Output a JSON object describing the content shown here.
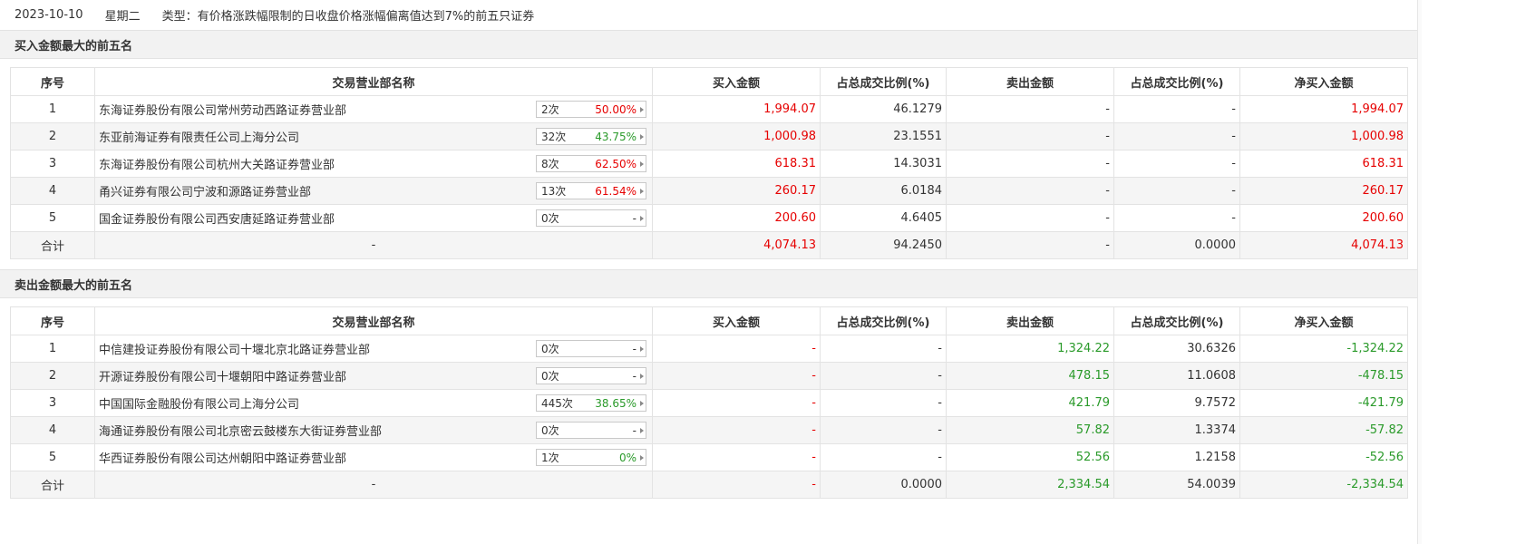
{
  "header": {
    "date": "2023-10-10",
    "weekday": "星期二",
    "type_text": "类型：有价格涨跌幅限制的日收盘价格涨幅偏离值达到7%的前五只证券"
  },
  "columns": [
    "序号",
    "交易营业部名称",
    "买入金额",
    "占总成交比例(%)",
    "卖出金额",
    "占总成交比例(%)",
    "净买入金额"
  ],
  "colors": {
    "up": "#e60000",
    "down": "#2a9a2a",
    "neutral": "#333333"
  },
  "buy_section": {
    "title": "买入金额最大的前五名",
    "rows": [
      {
        "idx": "1",
        "name": "东海证券股份有限公司常州劳动西路证券营业部",
        "times": "2次",
        "pct": "50.00%",
        "pct_color": "#e60000",
        "buy": "1,994.07",
        "buy_ratio": "46.1279",
        "sell": "-",
        "sell_ratio": "-",
        "net": "1,994.07",
        "net_color": "#e60000"
      },
      {
        "idx": "2",
        "name": "东亚前海证券有限责任公司上海分公司",
        "times": "32次",
        "pct": "43.75%",
        "pct_color": "#2a9a2a",
        "buy": "1,000.98",
        "buy_ratio": "23.1551",
        "sell": "-",
        "sell_ratio": "-",
        "net": "1,000.98",
        "net_color": "#e60000"
      },
      {
        "idx": "3",
        "name": "东海证券股份有限公司杭州大关路证券营业部",
        "times": "8次",
        "pct": "62.50%",
        "pct_color": "#e60000",
        "buy": "618.31",
        "buy_ratio": "14.3031",
        "sell": "-",
        "sell_ratio": "-",
        "net": "618.31",
        "net_color": "#e60000"
      },
      {
        "idx": "4",
        "name": "甬兴证券有限公司宁波和源路证券营业部",
        "times": "13次",
        "pct": "61.54%",
        "pct_color": "#e60000",
        "buy": "260.17",
        "buy_ratio": "6.0184",
        "sell": "-",
        "sell_ratio": "-",
        "net": "260.17",
        "net_color": "#e60000"
      },
      {
        "idx": "5",
        "name": "国金证券股份有限公司西安唐延路证券营业部",
        "times": "0次",
        "pct": "-",
        "pct_color": "#333333",
        "buy": "200.60",
        "buy_ratio": "4.6405",
        "sell": "-",
        "sell_ratio": "-",
        "net": "200.60",
        "net_color": "#e60000"
      }
    ],
    "total": {
      "label": "合计",
      "name": "-",
      "buy": "4,074.13",
      "buy_ratio": "94.2450",
      "sell": "-",
      "sell_ratio": "0.0000",
      "net": "4,074.13",
      "net_color": "#e60000"
    }
  },
  "sell_section": {
    "title": "卖出金额最大的前五名",
    "rows": [
      {
        "idx": "1",
        "name": "中信建投证券股份有限公司十堰北京北路证券营业部",
        "times": "0次",
        "pct": "-",
        "pct_color": "#333333",
        "buy": "-",
        "buy_ratio": "-",
        "sell": "1,324.22",
        "sell_ratio": "30.6326",
        "net": "-1,324.22",
        "net_color": "#2a9a2a"
      },
      {
        "idx": "2",
        "name": "开源证券股份有限公司十堰朝阳中路证券营业部",
        "times": "0次",
        "pct": "-",
        "pct_color": "#333333",
        "buy": "-",
        "buy_ratio": "-",
        "sell": "478.15",
        "sell_ratio": "11.0608",
        "net": "-478.15",
        "net_color": "#2a9a2a"
      },
      {
        "idx": "3",
        "name": "中国国际金融股份有限公司上海分公司",
        "times": "445次",
        "pct": "38.65%",
        "pct_color": "#2a9a2a",
        "buy": "-",
        "buy_ratio": "-",
        "sell": "421.79",
        "sell_ratio": "9.7572",
        "net": "-421.79",
        "net_color": "#2a9a2a"
      },
      {
        "idx": "4",
        "name": "海通证券股份有限公司北京密云鼓楼东大街证券营业部",
        "times": "0次",
        "pct": "-",
        "pct_color": "#333333",
        "buy": "-",
        "buy_ratio": "-",
        "sell": "57.82",
        "sell_ratio": "1.3374",
        "net": "-57.82",
        "net_color": "#2a9a2a"
      },
      {
        "idx": "5",
        "name": "华西证券股份有限公司达州朝阳中路证券营业部",
        "times": "1次",
        "pct": "0%",
        "pct_color": "#2a9a2a",
        "buy": "-",
        "buy_ratio": "-",
        "sell": "52.56",
        "sell_ratio": "1.2158",
        "net": "-52.56",
        "net_color": "#2a9a2a"
      }
    ],
    "total": {
      "label": "合计",
      "name": "-",
      "buy": "-",
      "buy_ratio": "0.0000",
      "sell": "2,334.54",
      "sell_ratio": "54.0039",
      "net": "-2,334.54",
      "net_color": "#2a9a2a"
    }
  }
}
